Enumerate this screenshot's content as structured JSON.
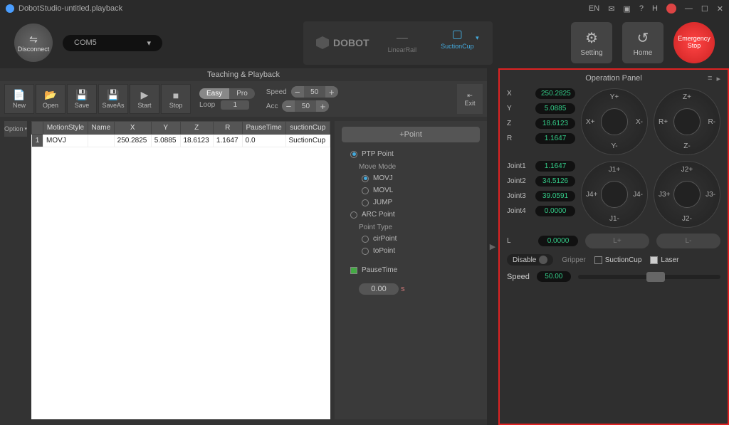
{
  "title": "DobotStudio-untitled.playback",
  "disconnect": "Disconnect",
  "com": "COM5",
  "logo": "DOBOT",
  "modes": {
    "linear": "LinearRail",
    "suction": "SuctionCup"
  },
  "topbtns": {
    "setting": "Setting",
    "home": "Home",
    "emergency": "Emergency\nStop"
  },
  "teach_title": "Teaching & Playback",
  "tools": {
    "new": "New",
    "open": "Open",
    "save": "Save",
    "saveas": "SaveAs",
    "start": "Start",
    "stop": "Stop",
    "exit": "Exit"
  },
  "mode_toggle": {
    "easy": "Easy",
    "pro": "Pro",
    "loop_label": "Loop",
    "loop": "1"
  },
  "speed": {
    "label": "Speed",
    "val": "50"
  },
  "acc": {
    "label": "Acc",
    "val": "50"
  },
  "option": "Option",
  "table": {
    "headers": [
      "MotionStyle",
      "Name",
      "X",
      "Y",
      "Z",
      "R",
      "PauseTime",
      "suctionCup"
    ],
    "row": {
      "style": "MOVJ",
      "name": "",
      "x": "250.2825",
      "y": "5.0885",
      "z": "18.6123",
      "r": "1.1647",
      "pause": "0.0",
      "tool": "SuctionCup"
    }
  },
  "point": {
    "add": "+Point",
    "ptp": "PTP Point",
    "move_mode": "Move Mode",
    "movj": "MOVJ",
    "movl": "MOVL",
    "jump": "JUMP",
    "arc": "ARC Point",
    "pt_type": "Point Type",
    "cir": "cirPoint",
    "to": "toPoint",
    "pausetime": "PauseTime",
    "pauseval": "0.00",
    "pauses": "s"
  },
  "op_title": "Operation Panel",
  "coords": {
    "X": "250.2825",
    "Y": "5.0885",
    "Z": "18.6123",
    "R": "1.1647"
  },
  "joints": {
    "Joint1": "1.1647",
    "Joint2": "34.5126",
    "Joint3": "39.0591",
    "Joint4": "0.0000"
  },
  "jog1": {
    "t": "Y+",
    "b": "Y-",
    "l": "X+",
    "r": "X-"
  },
  "jog2": {
    "t": "Z+",
    "b": "Z-",
    "l": "R+",
    "r": "R-"
  },
  "jog3": {
    "t": "J1+",
    "b": "J1-",
    "l": "J4+",
    "r": "J4-"
  },
  "jog4": {
    "t": "J2+",
    "b": "J2-",
    "l": "J3+",
    "r": "J3-"
  },
  "L": {
    "label": "L",
    "val": "0.0000",
    "plus": "L+",
    "minus": "L-"
  },
  "end": {
    "disable": "Disable",
    "gripper": "Gripper",
    "suction": "SuctionCup",
    "laser": "Laser"
  },
  "opspeed": {
    "label": "Speed",
    "val": "50.00"
  }
}
